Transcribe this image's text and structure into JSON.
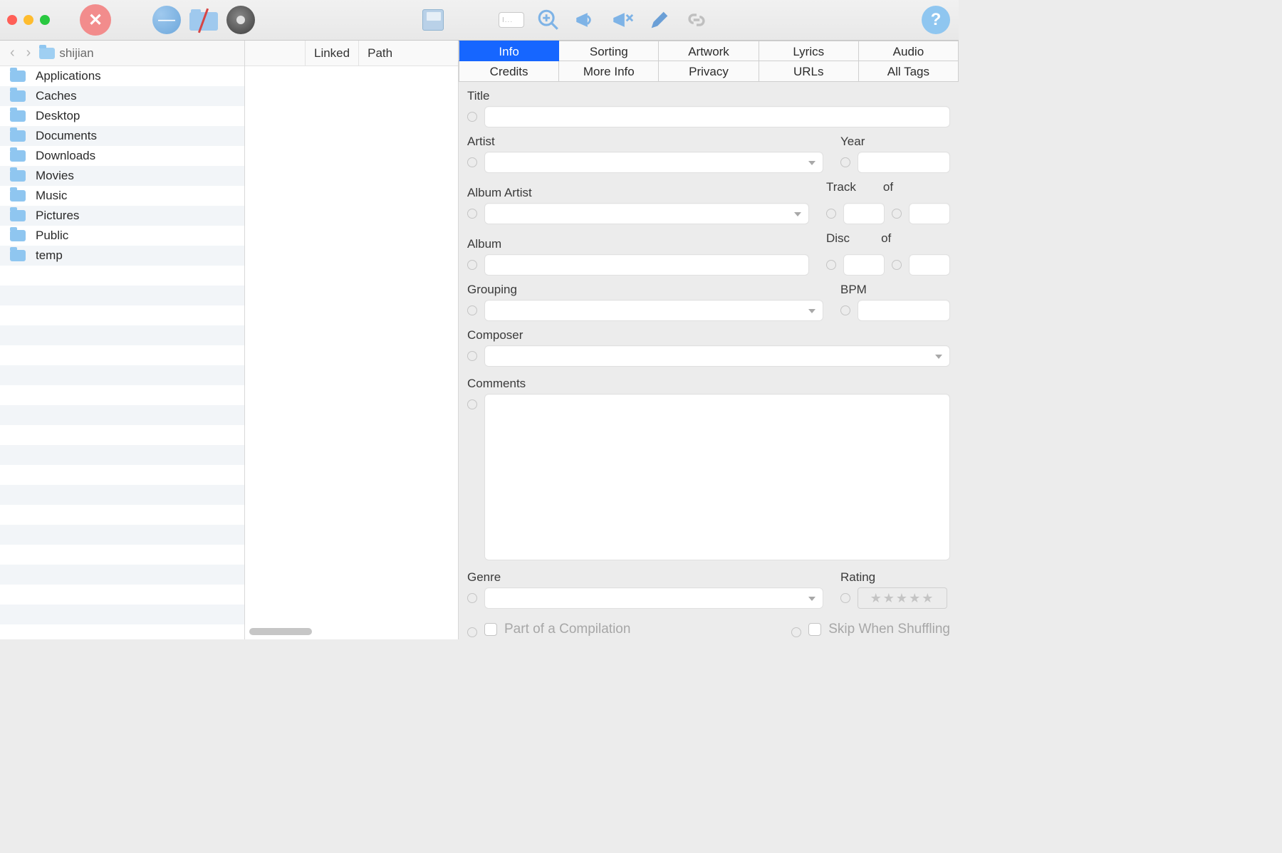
{
  "toolbar": {
    "text_placeholder": "I..."
  },
  "pathbar": {
    "current_folder": "shijian"
  },
  "folders": [
    {
      "label": "Applications"
    },
    {
      "label": "Caches"
    },
    {
      "label": "Desktop"
    },
    {
      "label": "Documents"
    },
    {
      "label": "Downloads"
    },
    {
      "label": "Movies"
    },
    {
      "label": "Music"
    },
    {
      "label": "Pictures"
    },
    {
      "label": "Public"
    },
    {
      "label": "temp"
    }
  ],
  "middle_columns": {
    "col1": "Linked",
    "col2": "Path"
  },
  "tabs_row1": [
    {
      "label": "Info",
      "active": true
    },
    {
      "label": "Sorting"
    },
    {
      "label": "Artwork"
    },
    {
      "label": "Lyrics"
    },
    {
      "label": "Audio"
    }
  ],
  "tabs_row2": [
    {
      "label": "Credits"
    },
    {
      "label": "More Info"
    },
    {
      "label": "Privacy"
    },
    {
      "label": "URLs"
    },
    {
      "label": "All Tags"
    }
  ],
  "labels": {
    "title": "Title",
    "artist": "Artist",
    "year": "Year",
    "album_artist": "Album Artist",
    "track": "Track",
    "of": "of",
    "album": "Album",
    "disc": "Disc",
    "grouping": "Grouping",
    "bpm": "BPM",
    "composer": "Composer",
    "comments": "Comments",
    "genre": "Genre",
    "rating": "Rating",
    "compilation": "Part of a Compilation",
    "skip_shuffle": "Skip When Shuffling"
  },
  "rating_stars": "★★★★★"
}
